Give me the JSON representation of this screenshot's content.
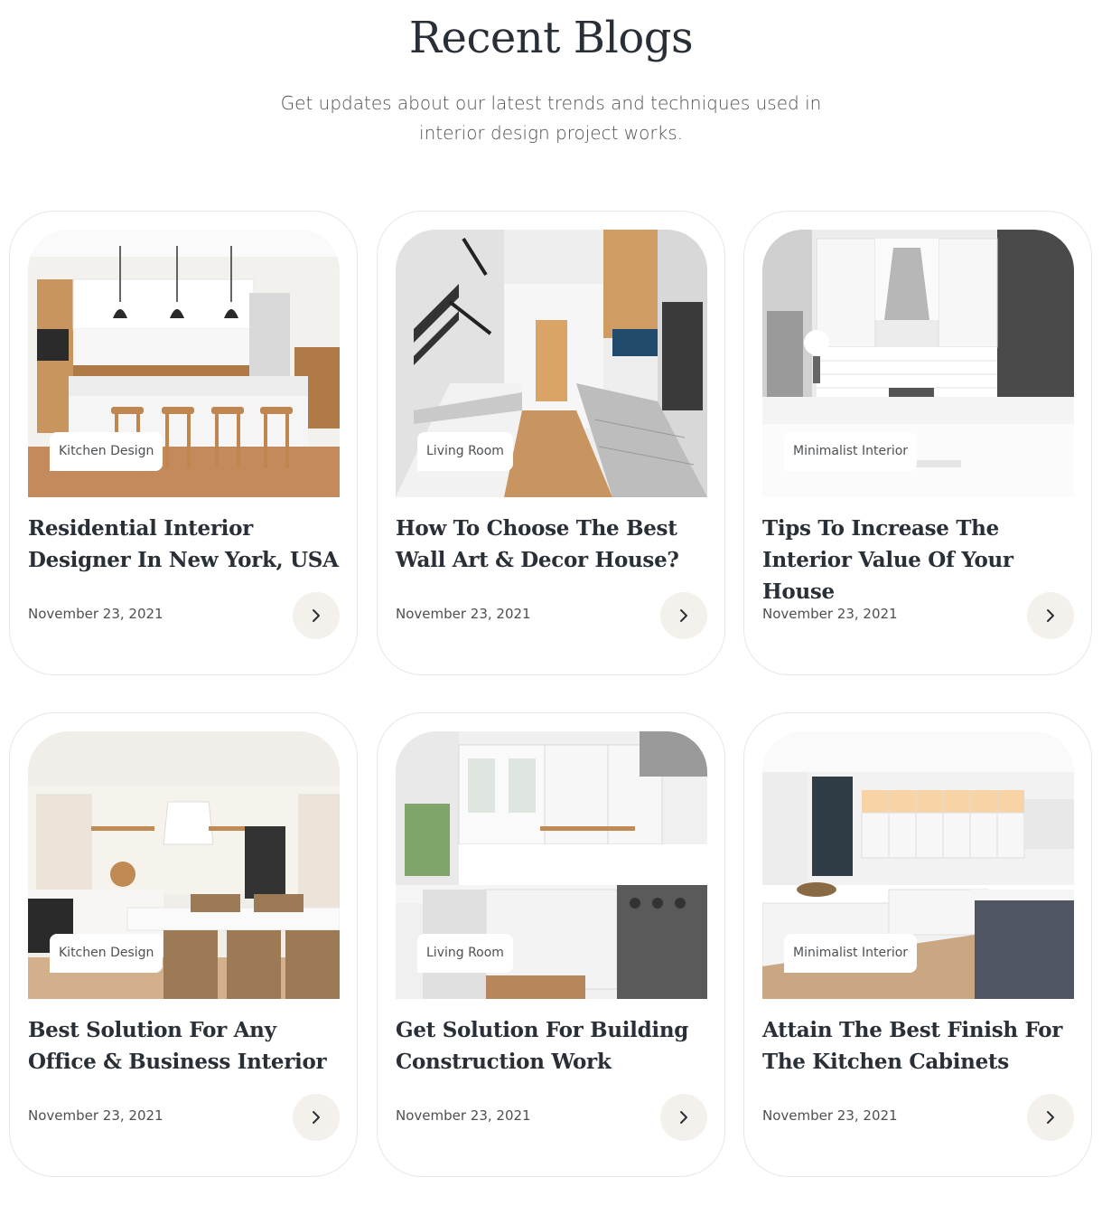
{
  "section": {
    "title": "Recent Blogs",
    "subtitle": "Get updates about our latest trends and techniques used in interior design project works."
  },
  "colors": {
    "heading": "#292F36",
    "body": "#4D5053",
    "button_bg": "#F4F0EC",
    "card_border": "#E7E7E7"
  },
  "posts": [
    {
      "tag": "Kitchen Design",
      "title": "Residential Interior Designer In New York, USA",
      "date": "November 23, 2021",
      "arrow_icon": "chevron-right-icon"
    },
    {
      "tag": "Living Room",
      "title": "How To Choose The Best Wall Art & Decor House?",
      "date": "November 23, 2021",
      "arrow_icon": "chevron-right-icon"
    },
    {
      "tag": "Minimalist Interior",
      "title": "Tips To Increase The Interior Value Of Your House",
      "date": "November 23, 2021",
      "arrow_icon": "chevron-right-icon"
    },
    {
      "tag": "Kitchen Design",
      "title": "Best Solution For Any Office & Business Interior",
      "date": "November 23, 2021",
      "arrow_icon": "chevron-right-icon"
    },
    {
      "tag": "Living Room",
      "title": "Get Solution For Building Construction Work",
      "date": "November 23, 2021",
      "arrow_icon": "chevron-right-icon"
    },
    {
      "tag": "Minimalist Interior",
      "title": "Attain The Best Finish For The Kitchen Cabinets",
      "date": "November 23, 2021",
      "arrow_icon": "chevron-right-icon"
    }
  ]
}
